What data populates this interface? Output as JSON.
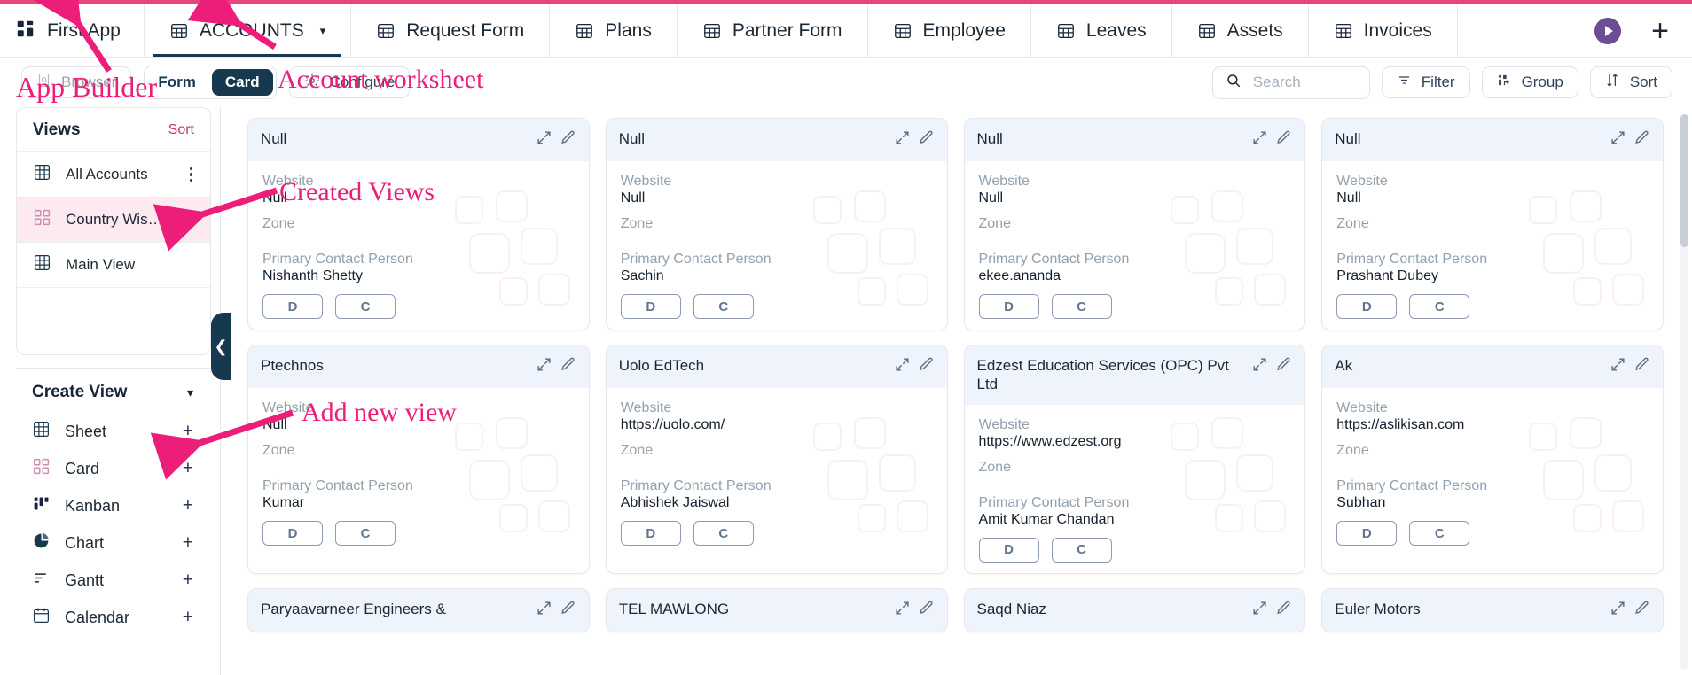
{
  "colors": {
    "accent_pink": "#e4467f",
    "annotation_pink": "#ec1e79",
    "dark_navy": "#17394f",
    "card_header_blue": "#eef3fc",
    "selected_view_pink": "#fdeaf1"
  },
  "topbar": {
    "brand": "First App",
    "tabs": [
      {
        "label": "ACCOUNTS",
        "icon": "table-icon",
        "active": true,
        "has_caret": true
      },
      {
        "label": "Request Form",
        "icon": "table-icon",
        "active": false,
        "has_caret": false
      },
      {
        "label": "Plans",
        "icon": "table-icon",
        "active": false,
        "has_caret": false
      },
      {
        "label": "Partner Form",
        "icon": "table-icon",
        "active": false,
        "has_caret": false
      },
      {
        "label": "Employee",
        "icon": "table-icon",
        "active": false,
        "has_caret": false
      },
      {
        "label": "Leaves",
        "icon": "table-icon",
        "active": false,
        "has_caret": false
      },
      {
        "label": "Assets",
        "icon": "table-icon",
        "active": false,
        "has_caret": false
      },
      {
        "label": "Invoices",
        "icon": "table-icon",
        "active": false,
        "has_caret": false
      }
    ],
    "play_label": "play-icon",
    "add_label": "+"
  },
  "toolbar": {
    "browser_label": "Browser",
    "form_label": "Form",
    "card_label": "Card",
    "configure_label": "Configure",
    "search_placeholder": "Search",
    "search_value": "",
    "filter_label": "Filter",
    "group_label": "Group",
    "sort_label": "Sort"
  },
  "views_panel": {
    "title": "Views",
    "sort_label": "Sort",
    "items": [
      {
        "label": "All Accounts",
        "icon": "sheet-icon",
        "selected": false
      },
      {
        "label": "Country Wise A...",
        "icon": "card-icon",
        "selected": true
      },
      {
        "label": "Main View",
        "icon": "sheet-icon",
        "selected": false
      }
    ]
  },
  "create_view": {
    "title": "Create View",
    "items": [
      {
        "label": "Sheet",
        "icon": "sheet-icon",
        "add": "+"
      },
      {
        "label": "Card",
        "icon": "card-icon",
        "add": "+"
      },
      {
        "label": "Kanban",
        "icon": "kanban-icon",
        "add": "+"
      },
      {
        "label": "Chart",
        "icon": "chart-pie-icon",
        "add": "+"
      },
      {
        "label": "Gantt",
        "icon": "gantt-icon",
        "add": "+"
      },
      {
        "label": "Calendar",
        "icon": "calendar-icon",
        "add": "+"
      }
    ]
  },
  "card_fields": {
    "website_label": "Website",
    "zone_label": "Zone",
    "contact_label": "Primary Contact Person",
    "btn_d": "D",
    "btn_c": "C"
  },
  "records": [
    {
      "title": "Null",
      "website": "Null",
      "zone": "",
      "contact": "Nishanth Shetty"
    },
    {
      "title": "Null",
      "website": "Null",
      "zone": "",
      "contact": "Sachin"
    },
    {
      "title": "Null",
      "website": "Null",
      "zone": "",
      "contact": "ekee.ananda"
    },
    {
      "title": "Null",
      "website": "Null",
      "zone": "",
      "contact": "Prashant Dubey"
    },
    {
      "title": "Ptechnos",
      "website": "Null",
      "zone": "",
      "contact": "Kumar"
    },
    {
      "title": "Uolo EdTech",
      "website": "https://uolo.com/",
      "zone": "",
      "contact": "Abhishek Jaiswal"
    },
    {
      "title": "Edzest Education Services (OPC) Pvt Ltd",
      "website": "https://www.edzest.org",
      "zone": "",
      "contact": "Amit Kumar Chandan"
    },
    {
      "title": "Ak",
      "website": "https://aslikisan.com",
      "zone": "",
      "contact": "Subhan"
    },
    {
      "title": "Paryaavarneer Engineers &",
      "website": "",
      "zone": "",
      "contact": ""
    },
    {
      "title": "TEL MAWLONG",
      "website": "",
      "zone": "",
      "contact": ""
    },
    {
      "title": "Saqd Niaz",
      "website": "",
      "zone": "",
      "contact": ""
    },
    {
      "title": "Euler Motors",
      "website": "",
      "zone": "",
      "contact": ""
    }
  ],
  "annotations": [
    {
      "text": "App Builder",
      "id": "anno-app-builder"
    },
    {
      "text": "Account worksheet",
      "id": "anno-account-worksheet"
    },
    {
      "text": "Created Views",
      "id": "anno-created-views"
    },
    {
      "text": "Add new view",
      "id": "anno-add-new-view"
    }
  ]
}
